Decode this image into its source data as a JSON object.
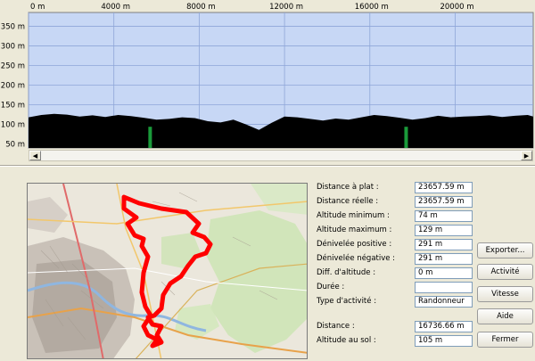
{
  "profile": {
    "chart_data": {
      "type": "area",
      "x_ticks": [
        0,
        4000,
        8000,
        12000,
        16000,
        20000
      ],
      "x_tick_labels": [
        "0 m",
        "4000 m",
        "8000 m",
        "12000 m",
        "16000 m",
        "20000 m"
      ],
      "y_ticks": [
        50,
        100,
        150,
        200,
        250,
        300,
        350
      ],
      "y_tick_labels": [
        "50 m",
        "100 m",
        "150 m",
        "200 m",
        "250 m",
        "300 m",
        "350 m"
      ],
      "xlim": [
        0,
        23658
      ],
      "ylim": [
        40,
        385
      ],
      "grid": true,
      "x": [
        0,
        600,
        1200,
        1800,
        2400,
        3000,
        3600,
        4200,
        4800,
        5400,
        6000,
        6600,
        7200,
        7800,
        8400,
        9000,
        9600,
        10200,
        10800,
        11400,
        12000,
        12600,
        13200,
        13800,
        14400,
        15000,
        15600,
        16200,
        16800,
        17400,
        18000,
        18600,
        19200,
        19800,
        20400,
        21000,
        21600,
        22200,
        22800,
        23400,
        23658
      ],
      "values": [
        118,
        124,
        127,
        125,
        120,
        123,
        119,
        124,
        121,
        117,
        112,
        114,
        118,
        116,
        108,
        105,
        112,
        100,
        86,
        104,
        120,
        118,
        114,
        110,
        115,
        112,
        118,
        124,
        121,
        117,
        112,
        116,
        122,
        118,
        120,
        121,
        123,
        119,
        122,
        124,
        120
      ],
      "markers": [
        5700,
        17700
      ]
    }
  },
  "scroll": {
    "left_arrow": "◀",
    "right_arrow": "▶"
  },
  "info": {
    "rows": [
      {
        "label": "Distance à plat :",
        "value": "23657.59 m"
      },
      {
        "label": "Distance réelle :",
        "value": "23657.59 m"
      },
      {
        "label": "Altitude minimum :",
        "value": "74 m"
      },
      {
        "label": "Altitude maximum :",
        "value": "129 m"
      },
      {
        "label": "Dénivelée positive :",
        "value": "291 m"
      },
      {
        "label": "Dénivelée négative :",
        "value": "291 m"
      },
      {
        "label": "Diff. d'altitude :",
        "value": "0 m"
      },
      {
        "label": "Durée :",
        "value": ""
      },
      {
        "label": "Type d'activité :",
        "value": "Randonneur"
      },
      {
        "label": "Distance :",
        "value": "16736.66 m"
      },
      {
        "label": "Altitude au sol :",
        "value": "105 m"
      }
    ]
  },
  "buttons": {
    "export": "Exporter...",
    "activity": "Activité",
    "speed": "Vitesse",
    "help": "Aide",
    "close": "Fermer"
  },
  "colors": {
    "sky": "#c7d7f5",
    "terrain": "#000000",
    "marker": "#1a9a3a",
    "route": "#ff0000"
  }
}
